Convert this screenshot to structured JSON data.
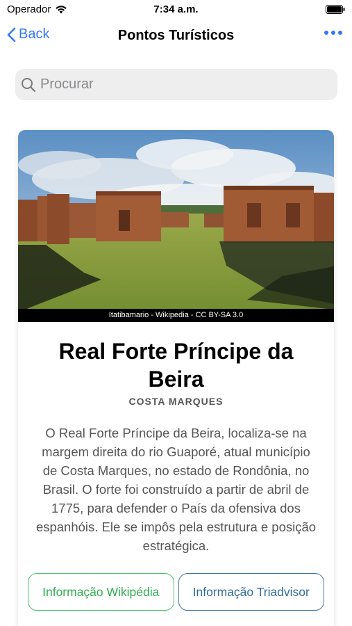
{
  "status_bar": {
    "carrier": "Operador",
    "time": "7:34 a.m."
  },
  "nav": {
    "back_label": "Back",
    "title": "Pontos Turísticos"
  },
  "search": {
    "placeholder": "Procurar"
  },
  "place": {
    "photo_credit": "Itatibamario - Wikipedia - CC BY-SA 3.0",
    "title": "Real Forte Príncipe da Beira",
    "subtitle": "COSTA MARQUES",
    "description": "O Real Forte Príncipe da Beira, localiza-se na margem direita do rio Guaporé, atual município de Costa Marques, no estado de Rondônia, no Brasil. O forte foi construído a partir de abril de 1775, para defender o País da ofensiva dos espanhóis. Ele se impôs pela estrutura e posição estratégica.",
    "buttons": {
      "wikipedia": "Informação Wikipédia",
      "tripadvisor": "Informação Triadvisor"
    }
  },
  "colors": {
    "accent": "#3478f6",
    "wiki_button": "#49c26b",
    "trip_button": "#3a78a8"
  },
  "icons": [
    "wifi-icon",
    "battery-icon",
    "chevron-left-icon",
    "more-icon",
    "search-icon"
  ]
}
